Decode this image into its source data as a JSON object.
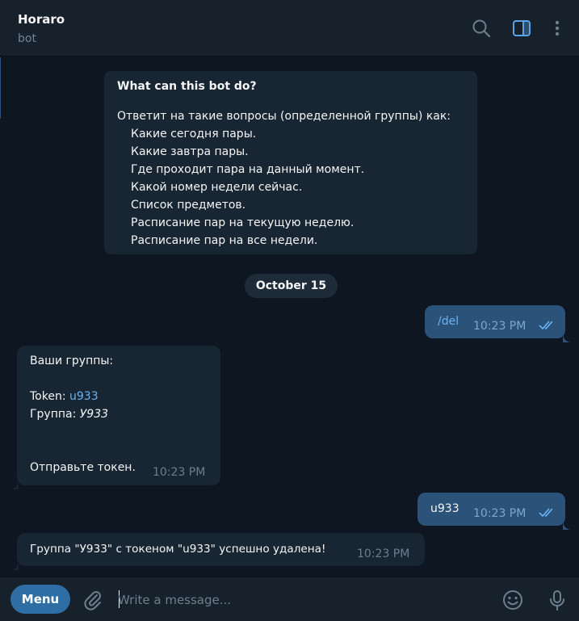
{
  "header": {
    "title": "Horaro",
    "subtitle": "bot"
  },
  "bot_info": {
    "title": "What can this bot do?",
    "intro": "Ответит на такие вопросы (определенной группы) как:",
    "items": [
      "Какие сегодня пары.",
      "Какие завтра пары.",
      "Где проходит пара на данный момент.",
      "Какой номер недели сейчас.",
      "Список предметов.",
      "Расписание пар на текущую неделю.",
      "Расписание пар на все недели."
    ]
  },
  "date_separator": "October 15",
  "messages": {
    "m1": {
      "text": "/del",
      "time": "10:23 PM"
    },
    "m2": {
      "line1": "Ваши группы:",
      "token_label": "Token: ",
      "token_value": "u933",
      "group_label": "Группа: ",
      "group_value": "У933",
      "footer": "Отправьте токен.",
      "time": "10:23 PM"
    },
    "m3": {
      "text": "u933",
      "time": "10:23 PM"
    },
    "m4": {
      "text": "Группа \"У933\" с токеном \"u933\" успешно удалена!",
      "time": "10:23 PM"
    }
  },
  "composer": {
    "menu_label": "Menu",
    "placeholder": "Write a message..."
  },
  "colors": {
    "background": "#0e1621",
    "header": "#17212b",
    "incoming_bubble": "#182533",
    "outgoing_bubble": "#2b5278",
    "accent": "#6ab3f3",
    "menu_button": "#2f6ea5"
  },
  "icons": [
    "search-icon",
    "sidebar-toggle-icon",
    "more-vertical-icon",
    "attach-icon",
    "emoji-icon",
    "microphone-icon",
    "double-check-icon"
  ]
}
